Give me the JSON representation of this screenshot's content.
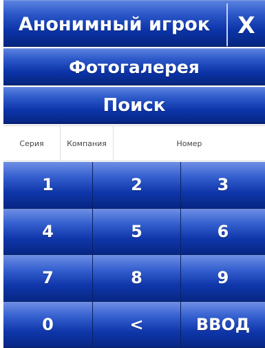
{
  "header": {
    "title": "Анонимный игрок",
    "close_label": "X"
  },
  "buttons": {
    "gallery_label": "Фотогалерея",
    "search_label": "Поиск"
  },
  "fields": {
    "series_placeholder": "Серия",
    "company_placeholder": "Компания",
    "number_placeholder": "Номер"
  },
  "keypad": {
    "keys": [
      "1",
      "2",
      "3",
      "4",
      "5",
      "6",
      "7",
      "8",
      "9",
      "0",
      "<",
      "ВВОД"
    ]
  },
  "colors": {
    "button_top": "#5a82e0",
    "button_mid": "#0c34a8",
    "button_bottom": "#06257e",
    "text": "#ffffff"
  }
}
